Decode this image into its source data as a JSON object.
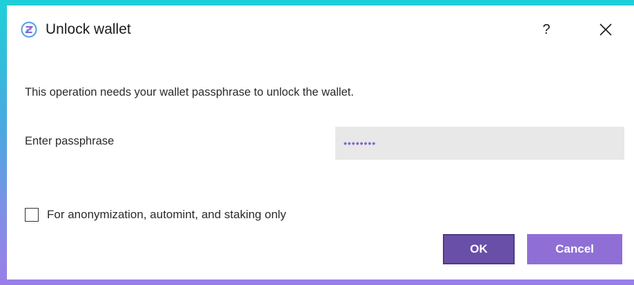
{
  "window": {
    "title": "Unlock wallet",
    "help_label": "?",
    "close_icon": "close-icon",
    "app_icon": "wallet-app-icon"
  },
  "main": {
    "message": "This operation needs your wallet passphrase to unlock the wallet.",
    "passphrase_label": "Enter passphrase",
    "passphrase_masked": "••••••••",
    "checkbox_label": "For anonymization, automint, and staking only",
    "checkbox_checked": false
  },
  "buttons": {
    "ok_label": "OK",
    "cancel_label": "Cancel"
  },
  "colors": {
    "accent": "#8f6fd6",
    "accent_dark": "#6a4fa8",
    "frame_top": "#1fcfd8",
    "frame_bottom": "#9a7ee8"
  }
}
